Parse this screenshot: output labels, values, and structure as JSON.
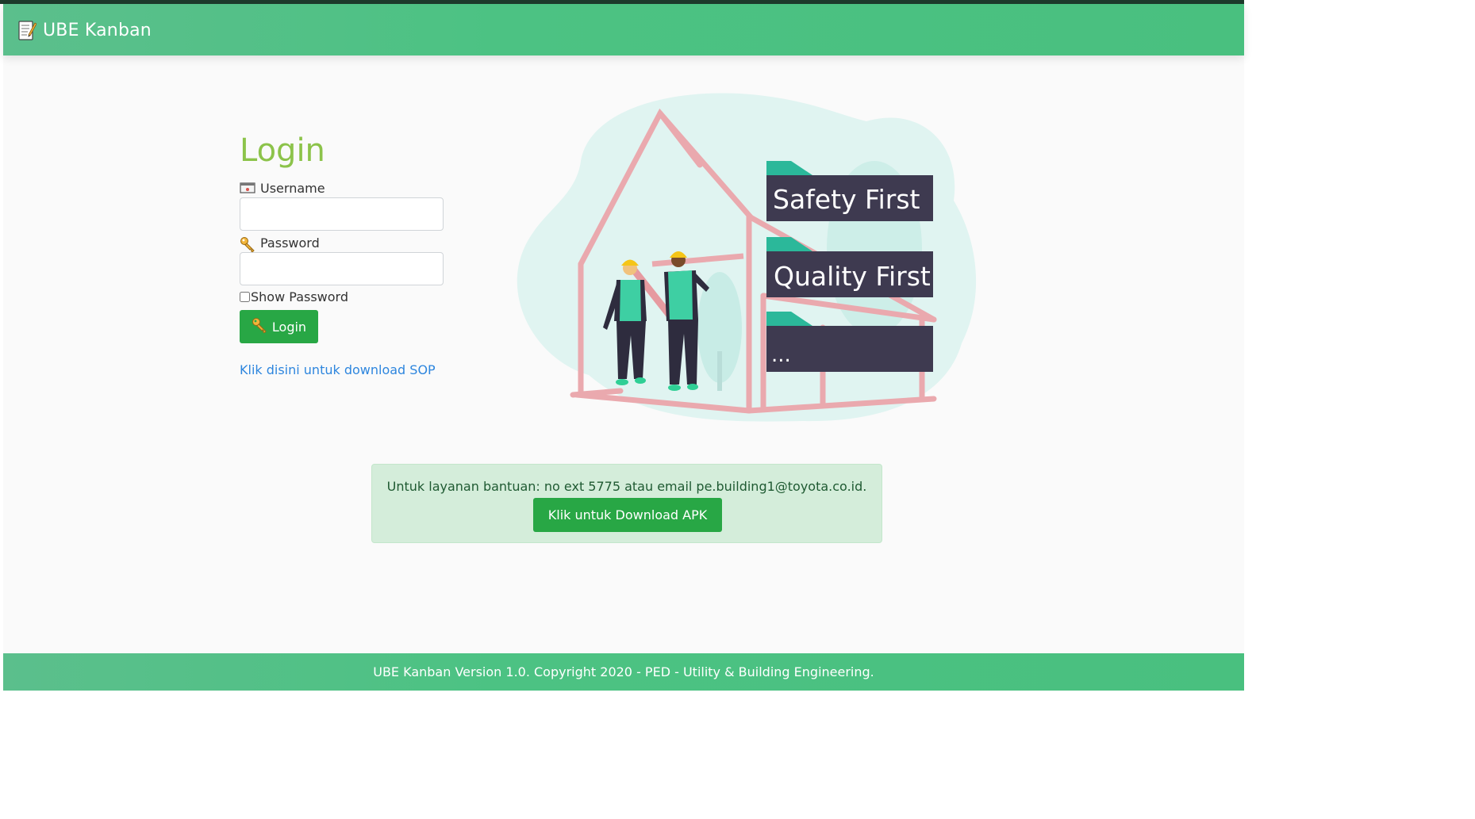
{
  "app": {
    "brand": "UBE Kanban",
    "brand_icon": "memo-icon",
    "accent": "#4cc283"
  },
  "login": {
    "title": "Login",
    "username_label": "Username",
    "username_icon": "id-card-icon",
    "username_value": "",
    "password_label": "Password",
    "password_icon": "key-icon",
    "password_value": "",
    "show_password_label": "Show Password",
    "show_password_checked": false,
    "submit_label": "Login",
    "sop_link": "Klik disini untuk download SOP"
  },
  "illustration": {
    "signs": [
      "Safety First",
      "Quality First",
      "..."
    ]
  },
  "help": {
    "text": "Untuk layanan bantuan: no ext 5775 atau email pe.building1@toyota.co.id.",
    "apk_button": "Klik untuk Download APK"
  },
  "footer": {
    "text": "UBE Kanban Version 1.0. Copyright 2020 - PED - Utility & Building Engineering."
  },
  "colors": {
    "navbar": "#4cc283",
    "login_title": "#8cc34a",
    "button": "#28a745",
    "link": "#2e86de",
    "alert_bg": "#d4edda",
    "sign_bg": "#3e3a50"
  }
}
